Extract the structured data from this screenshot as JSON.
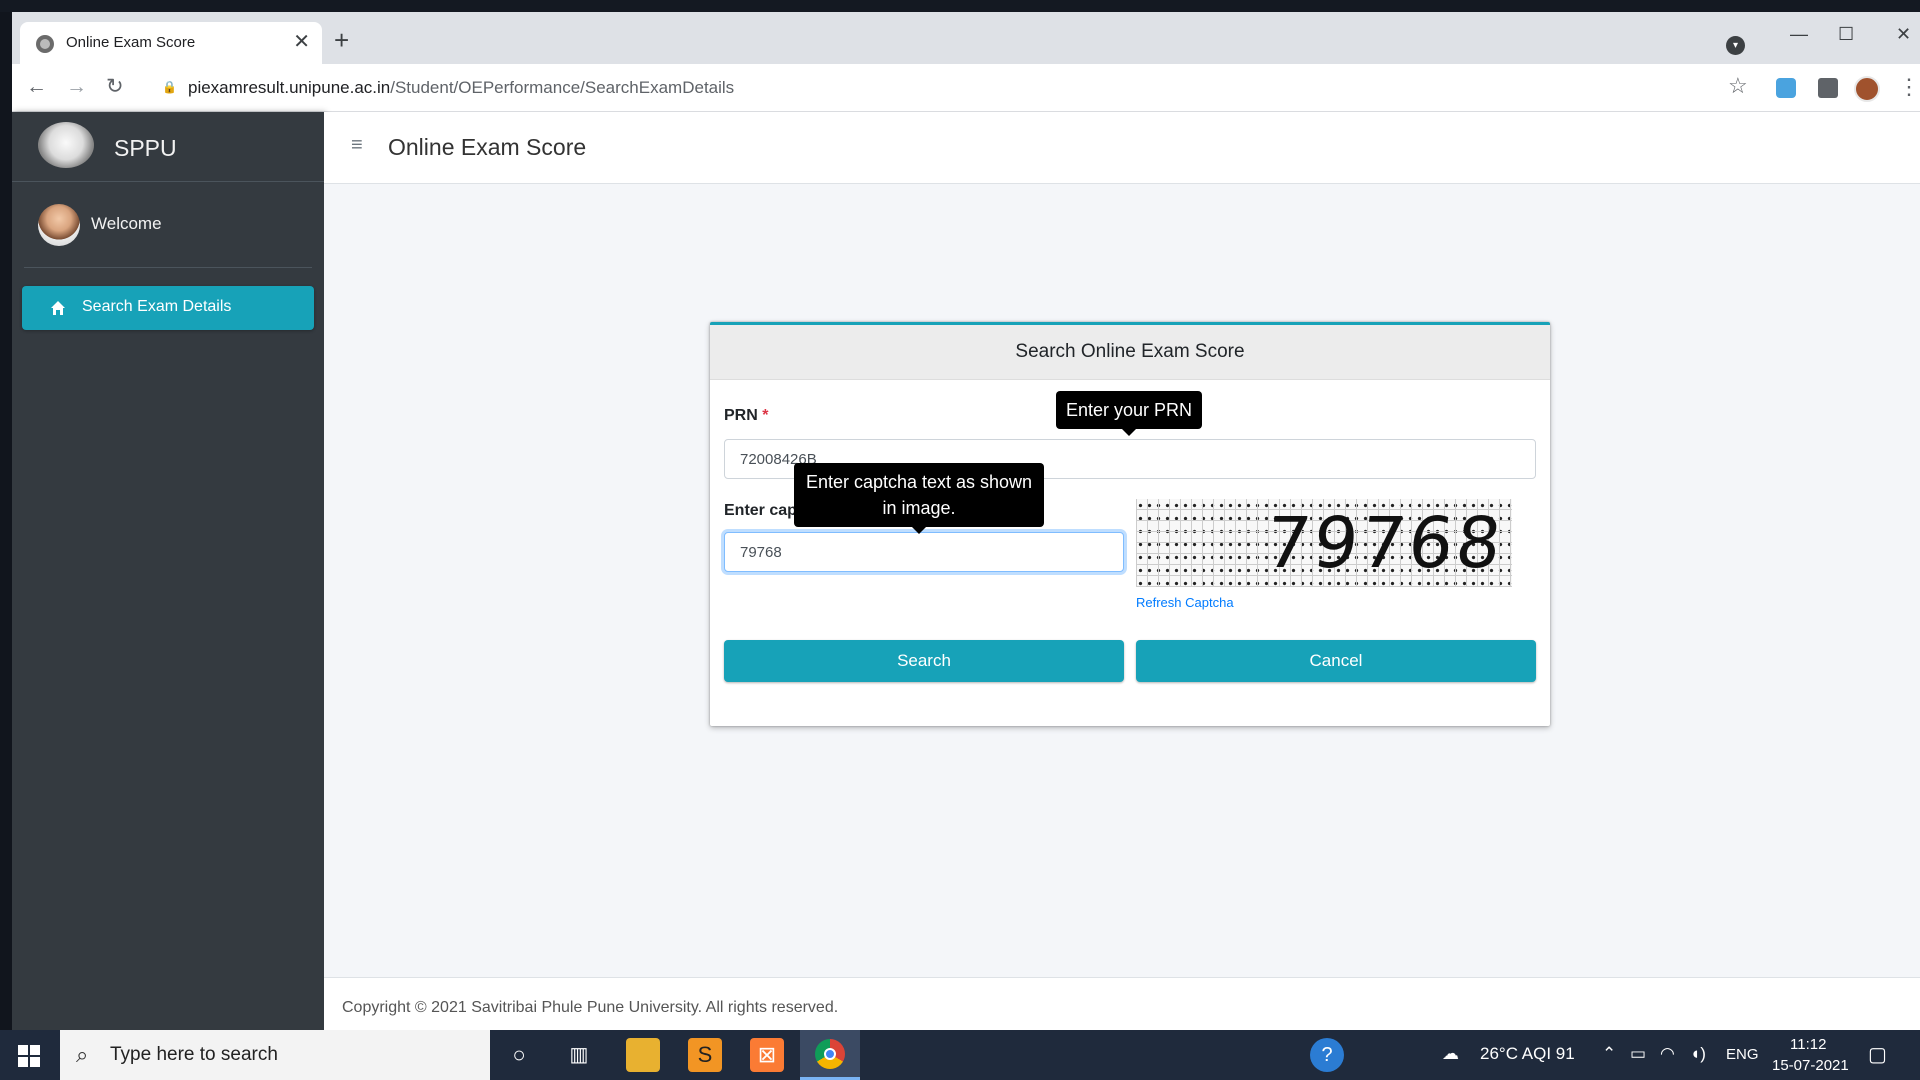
{
  "browser": {
    "tab_title": "Online Exam Score",
    "tab_close": "✕",
    "new_tab": "+",
    "url_domain": "piexamresult.unipune.ac.in",
    "url_path": "/Student/OEPerformance/SearchExamDetails",
    "controls": {
      "minimize": "—",
      "maximize": "☐",
      "close": "✕"
    }
  },
  "sidebar": {
    "brand": "SPPU",
    "user": "Welcome",
    "nav_item": "Search Exam Details"
  },
  "header": {
    "menu_icon": "≡",
    "title": "Online Exam Score"
  },
  "form": {
    "card_title": "Search Online Exam Score",
    "prn_label": "PRN",
    "prn_value": "72008426B",
    "captcha_label": "Enter captcha text as shown in image",
    "required_mark": "*",
    "captcha_value": "79768",
    "captcha_image_text": "79768",
    "refresh_link": "Refresh Captcha",
    "search_button": "Search",
    "cancel_button": "Cancel",
    "prn_tooltip": "Enter your PRN",
    "captcha_tooltip": "Enter captcha text as shown in image."
  },
  "footer": {
    "text": "Copyright © 2021 Savitribai Phule Pune University. All rights reserved."
  },
  "taskbar": {
    "search_placeholder": "Type here to search",
    "weather": "26°C  AQI 91",
    "language": "ENG",
    "time": "11:12",
    "date": "15-07-2021"
  },
  "colors": {
    "accent": "#17a2b8",
    "sidebar": "#343a40",
    "tooltip": "#000000"
  }
}
